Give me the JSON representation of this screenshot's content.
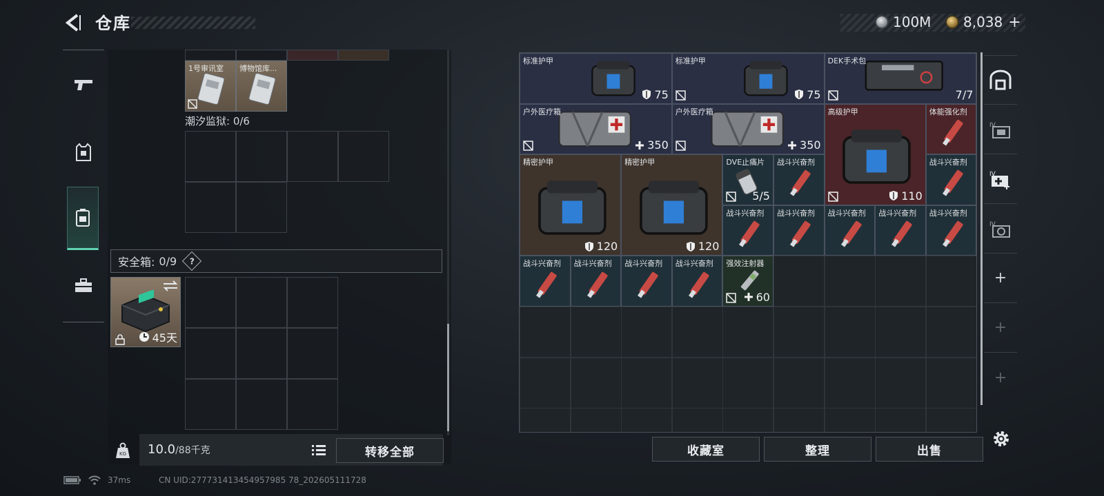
{
  "header": {
    "title": "仓库"
  },
  "currency": {
    "silver": "100M",
    "gold": "8,038",
    "gold_add": "+"
  },
  "left_panel": {
    "top_items": [
      {
        "label": "1号审讯室"
      },
      {
        "label": "博物馆库..."
      }
    ],
    "prison_label": "潮汐监狱: 0/6",
    "safebox_label": "安全箱:",
    "safebox_count": "0/9",
    "help": "?",
    "safebox_days": "45天",
    "weight": {
      "value": "10.0",
      "limit": "/88千克"
    },
    "transfer_all": "转移全部"
  },
  "stash": {
    "items": [
      {
        "label": "标准护甲",
        "value": "75",
        "icon": "shield",
        "color": "blue"
      },
      {
        "label": "标准护甲",
        "value": "75",
        "icon": "shield",
        "color": "blue"
      },
      {
        "label": "DEK手术包",
        "value": "7/7",
        "icon": "",
        "color": "blue"
      },
      {
        "label": "户外医疗箱",
        "value": "350",
        "icon": "plus",
        "color": "blue"
      },
      {
        "label": "户外医疗箱",
        "value": "350",
        "icon": "plus",
        "color": "blue"
      },
      {
        "label": "高级护甲",
        "value": "110",
        "icon": "shield",
        "color": "red"
      },
      {
        "label": "体能强化剂",
        "value": "",
        "icon": "",
        "color": "red"
      },
      {
        "label": "精密护甲",
        "value": "120",
        "icon": "shield",
        "color": "brown"
      },
      {
        "label": "精密护甲",
        "value": "120",
        "icon": "shield",
        "color": "brown"
      },
      {
        "label": "DVE止痛片",
        "value": "5/5",
        "icon": "",
        "color": "teal"
      },
      {
        "label": "战斗兴奋剂",
        "value": "",
        "icon": "",
        "color": "teal"
      },
      {
        "label": "战斗兴奋剂",
        "value": "",
        "icon": "",
        "color": "teal"
      },
      {
        "label": "战斗兴奋剂",
        "value": "",
        "icon": "",
        "color": "teal"
      },
      {
        "label": "战斗兴奋剂",
        "value": "",
        "icon": "",
        "color": "teal"
      },
      {
        "label": "战斗兴奋剂",
        "value": "",
        "icon": "",
        "color": "teal"
      },
      {
        "label": "战斗兴奋剂",
        "value": "",
        "icon": "",
        "color": "teal"
      },
      {
        "label": "战斗兴奋剂",
        "value": "",
        "icon": "",
        "color": "teal"
      },
      {
        "label": "战斗兴奋剂",
        "value": "",
        "icon": "",
        "color": "teal"
      },
      {
        "label": "战斗兴奋剂",
        "value": "",
        "icon": "",
        "color": "teal"
      },
      {
        "label": "战斗兴奋剂",
        "value": "",
        "icon": "",
        "color": "teal"
      },
      {
        "label": "战斗兴奋剂",
        "value": "",
        "icon": "",
        "color": "teal"
      },
      {
        "label": "战斗兴奋剂",
        "value": "",
        "icon": "",
        "color": "teal"
      },
      {
        "label": "强效注射器",
        "value": "60",
        "icon": "plus",
        "color": "green"
      }
    ],
    "buttons": {
      "collection": "收藏室",
      "organize": "整理",
      "sell": "出售"
    }
  },
  "status": {
    "ping": "37ms",
    "uid": "CN UID:277731413454957985 78_202605111728"
  },
  "colors": {
    "accent": "#5fd3b0",
    "blue": "#2a2f44",
    "red": "#4a2428",
    "brown": "#3e342c"
  }
}
